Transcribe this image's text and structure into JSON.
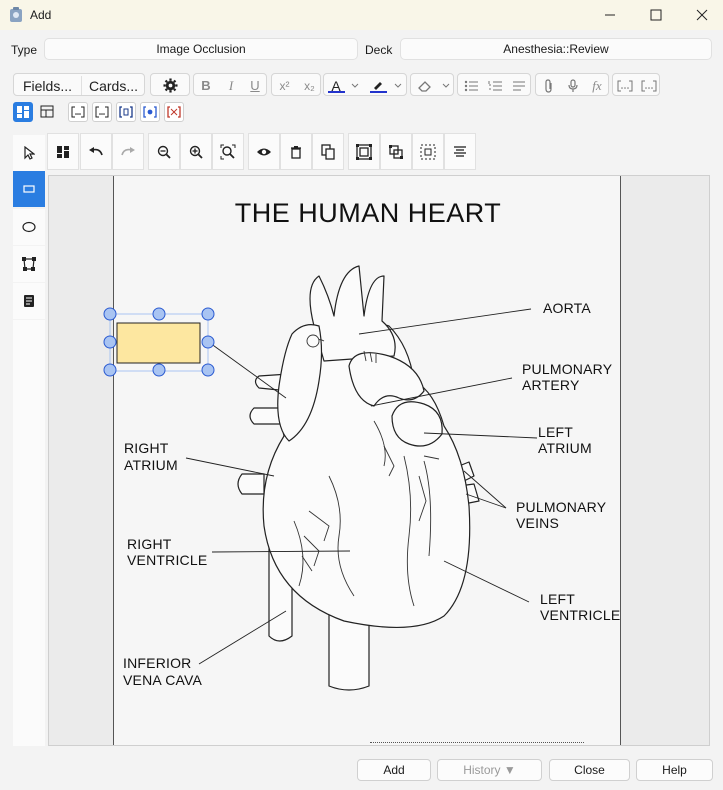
{
  "window": {
    "title": "Add"
  },
  "type_row": {
    "type_label": "Type",
    "type_value": "Image Occlusion",
    "deck_label": "Deck",
    "deck_value": "Anesthesia::Review"
  },
  "toolbar": {
    "fields_label": "Fields...",
    "cards_label": "Cards...",
    "bold": "B",
    "italic": "I",
    "underline": "U",
    "superscript": "x²",
    "subscript": "x₂",
    "text_color": "A",
    "formula": "fx"
  },
  "occlusion_tools": [
    "select",
    "rectangle",
    "ellipse",
    "polygon",
    "text"
  ],
  "image": {
    "title": "THE HUMAN HEART",
    "labels": {
      "aorta": "AORTA",
      "pulmonary_artery_1": "PULMONARY",
      "pulmonary_artery_2": "ARTERY",
      "left_atrium_1": "LEFT",
      "left_atrium_2": "ATRIUM",
      "right_atrium_1": "RIGHT",
      "right_atrium_2": "ATRIUM",
      "pulmonary_veins_1": "PULMONARY",
      "pulmonary_veins_2": "VEINS",
      "right_ventricle_1": "RIGHT",
      "right_ventricle_2": "VENTRICLE",
      "left_ventricle_1": "LEFT",
      "left_ventricle_2": "VENTRICLE",
      "ivc_1": "INFERIOR",
      "ivc_2": "VENA CAVA"
    },
    "mask_color": "#fde7a0",
    "handle_color": "#a9c4f2"
  },
  "footer": {
    "add": "Add",
    "history": "History ▼",
    "close": "Close",
    "help": "Help"
  },
  "colors": {
    "accent": "#2a7de1",
    "text_color_bar": "#2233cc"
  }
}
